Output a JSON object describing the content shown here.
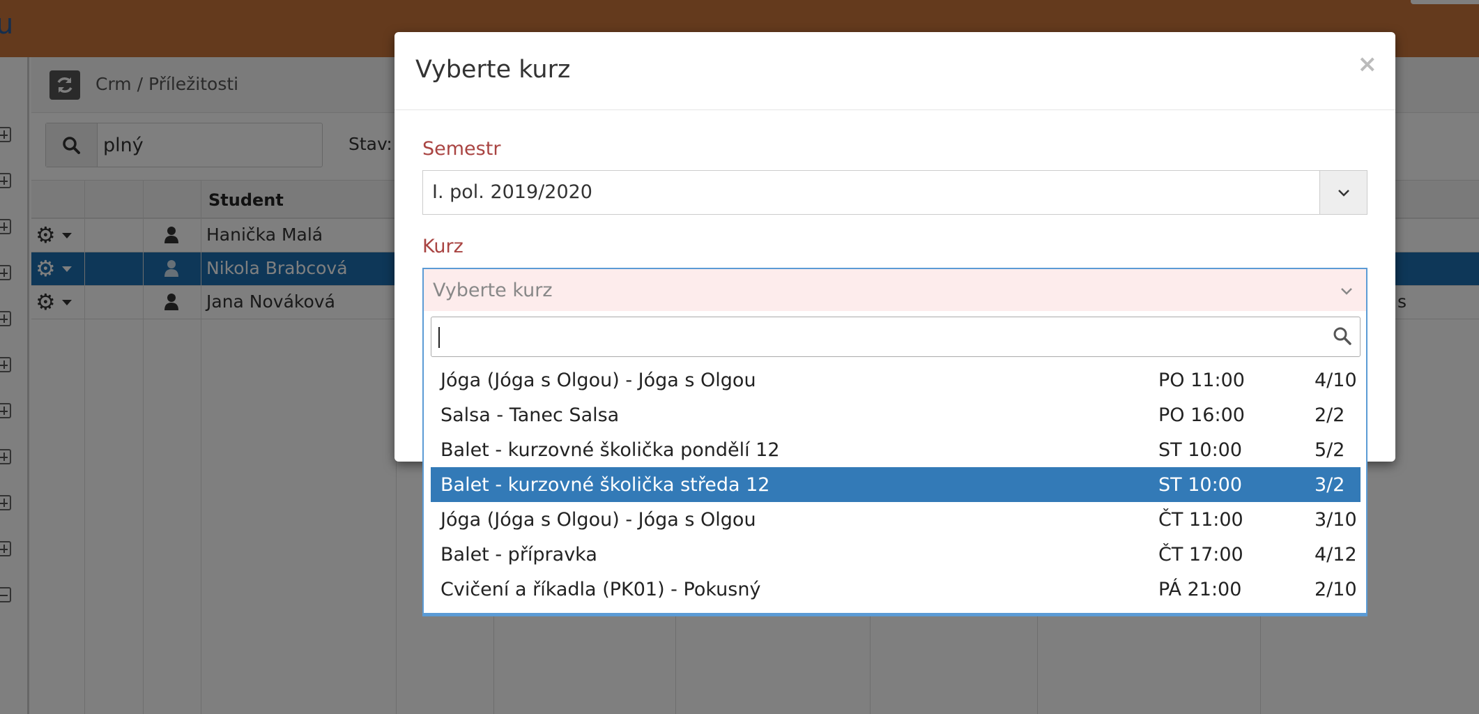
{
  "app": {
    "brand_fragment": "u",
    "breadcrumb": "Crm / Příležitosti",
    "search_value": "plný",
    "stav_label": "Stav:",
    "table": {
      "header_student": "Student",
      "rows": [
        {
          "name": "Hanička Malá",
          "selected": false,
          "right_fragment": ""
        },
        {
          "name": "Nikola Brabcová",
          "selected": true,
          "right_fragment": ""
        },
        {
          "name": "Jana Nováková",
          "selected": false,
          "right_fragment": "s"
        }
      ]
    }
  },
  "modal": {
    "title": "Vyberte kurz",
    "close_label": "×",
    "semestr": {
      "label": "Semestr",
      "value": "I. pol. 2019/2020"
    },
    "kurz": {
      "label": "Kurz",
      "placeholder": "Vyberte kurz",
      "search_value": "",
      "options": [
        {
          "name": "Jóga (Jóga s Olgou) - Jóga s Olgou",
          "time": "PO 11:00",
          "capacity": "4/10"
        },
        {
          "name": "Salsa - Tanec Salsa",
          "time": "PO 16:00",
          "capacity": "2/2"
        },
        {
          "name": "Balet - kurzovné školička pondělí 12",
          "time": "ST 10:00",
          "capacity": "5/2"
        },
        {
          "name": "Balet - kurzovné školička středa 12",
          "time": "ST 10:00",
          "capacity": "3/2"
        },
        {
          "name": "Jóga (Jóga s Olgou) - Jóga s Olgou",
          "time": "ČT 11:00",
          "capacity": "3/10"
        },
        {
          "name": "Balet - přípravka",
          "time": "ČT 17:00",
          "capacity": "4/12"
        },
        {
          "name": "Cvičení a říkadla (PK01) - Pokusný",
          "time": "PÁ 21:00",
          "capacity": "2/10"
        }
      ],
      "highlighted_index": 3
    }
  },
  "colors": {
    "topbar": "#c8753a",
    "label_error": "#a94442",
    "selected_row": "#1d6fb0",
    "highlight": "#337ab7",
    "focus_border": "#5b9bd5"
  }
}
